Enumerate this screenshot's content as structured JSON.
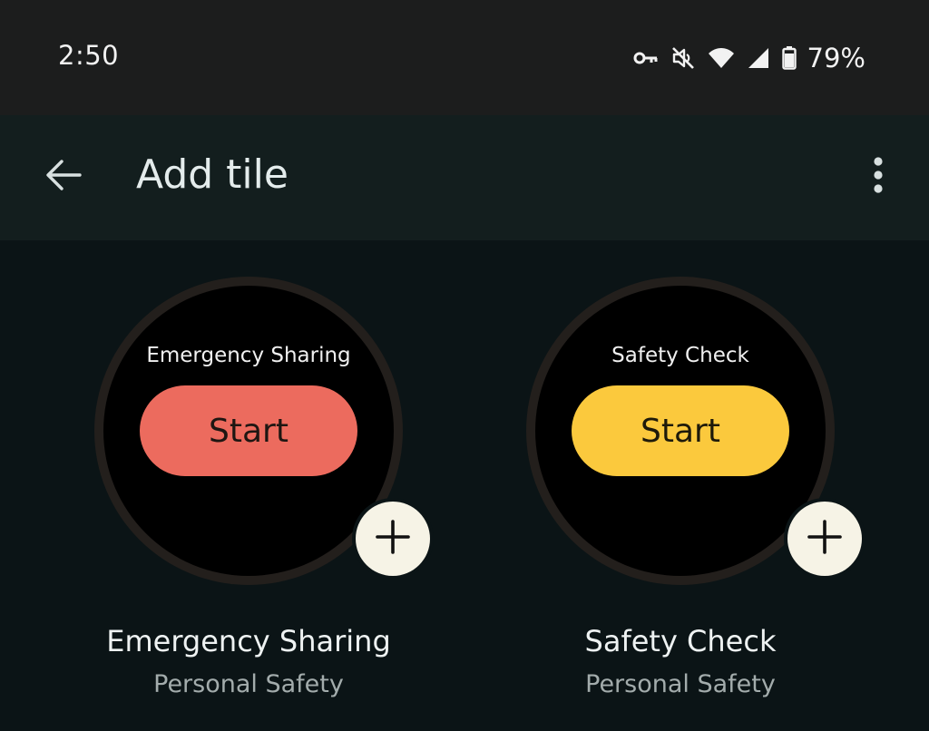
{
  "status_bar": {
    "time": "2:50",
    "battery_percent": "79%",
    "icons": [
      "vpn-key-icon",
      "mute-icon",
      "wifi-icon",
      "signal-icon",
      "battery-icon"
    ]
  },
  "app_bar": {
    "title": "Add tile",
    "back_icon": "arrow-back-icon",
    "overflow_icon": "more-vert-icon"
  },
  "tiles": [
    {
      "heading": "Emergency Sharing",
      "action_label": "Start",
      "action_color": "#ec6b5e",
      "name": "Emergency Sharing",
      "app": "Personal Safety",
      "add_icon": "plus-icon"
    },
    {
      "heading": "Safety Check",
      "action_label": "Start",
      "action_color": "#fbc93d",
      "name": "Safety Check",
      "app": "Personal Safety",
      "add_icon": "plus-icon"
    }
  ]
}
